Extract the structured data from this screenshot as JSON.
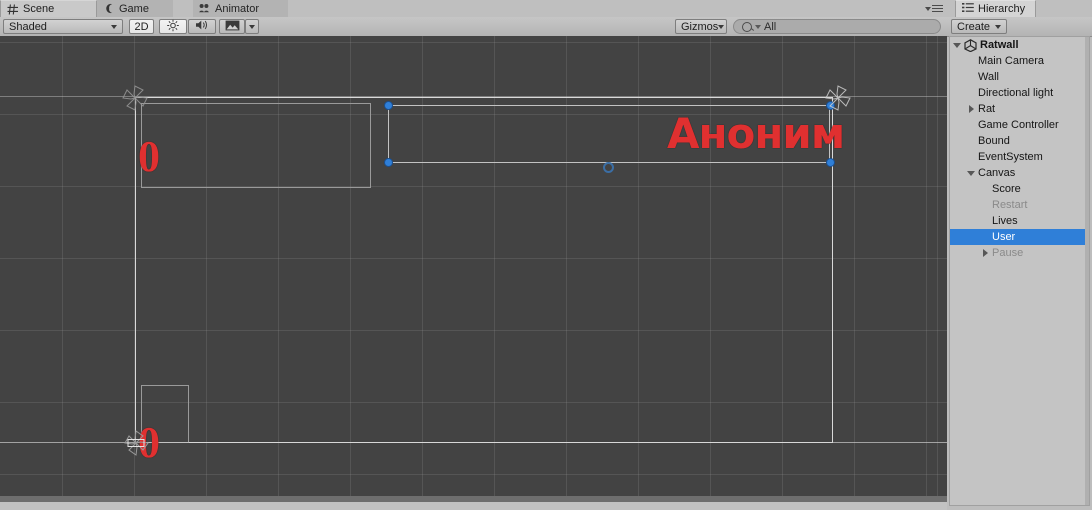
{
  "window": {
    "scene_tabs": [
      {
        "label": "Scene",
        "icon": "grid-icon",
        "active": true
      },
      {
        "label": "Game",
        "icon": "gamepad-icon",
        "active": false
      },
      {
        "label": "Animator",
        "icon": "animator-icon",
        "active": false
      }
    ],
    "tab_menu_icon": "panel-menu-icon"
  },
  "scene_toolbar": {
    "draw_mode": "Shaded",
    "mode_2d": "2D",
    "lighting_icon": "sun-icon",
    "audio_icon": "speaker-icon",
    "effects_icon": "image-icon",
    "effects_caret": "chevron-down-icon",
    "gizmos": "Gizmos",
    "search_placeholder": "All",
    "search_value": "All",
    "search_icon": "search-icon"
  },
  "scene_view": {
    "background_color": "#434343",
    "grid_color": "#8e8e8e",
    "canvas_outline_color": "#d9d9d9",
    "handle_color": "#2f7fd8",
    "text_color": "#e03030",
    "text_outline_color": "#1b1b1b",
    "objects": [
      {
        "name": "score-text",
        "text": "0",
        "role": "Score"
      },
      {
        "name": "lives-text",
        "text": "0",
        "role": "Lives"
      },
      {
        "name": "user-text",
        "text": "Аноним",
        "role": "User"
      }
    ]
  },
  "hierarchy": {
    "tab_label": "Hierarchy",
    "tab_icon": "hierarchy-icon",
    "create_label": "Create",
    "create_caret": "chevron-down-icon",
    "items": [
      {
        "label": "Ratwall",
        "depth": 0,
        "twisty": "down",
        "icon": "unity-scene-icon",
        "root": true,
        "selected": false,
        "dim": false
      },
      {
        "label": "Main Camera",
        "depth": 1,
        "twisty": "none",
        "icon": "none",
        "root": false,
        "selected": false,
        "dim": false
      },
      {
        "label": "Wall",
        "depth": 1,
        "twisty": "none",
        "icon": "none",
        "root": false,
        "selected": false,
        "dim": false
      },
      {
        "label": "Directional light",
        "depth": 1,
        "twisty": "none",
        "icon": "none",
        "root": false,
        "selected": false,
        "dim": false
      },
      {
        "label": "Rat",
        "depth": 1,
        "twisty": "right",
        "icon": "none",
        "root": false,
        "selected": false,
        "dim": false
      },
      {
        "label": "Game Controller",
        "depth": 1,
        "twisty": "none",
        "icon": "none",
        "root": false,
        "selected": false,
        "dim": false
      },
      {
        "label": "Bound",
        "depth": 1,
        "twisty": "none",
        "icon": "none",
        "root": false,
        "selected": false,
        "dim": false
      },
      {
        "label": "EventSystem",
        "depth": 1,
        "twisty": "none",
        "icon": "none",
        "root": false,
        "selected": false,
        "dim": false
      },
      {
        "label": "Canvas",
        "depth": 1,
        "twisty": "down",
        "icon": "none",
        "root": false,
        "selected": false,
        "dim": false
      },
      {
        "label": "Score",
        "depth": 2,
        "twisty": "none",
        "icon": "none",
        "root": false,
        "selected": false,
        "dim": false
      },
      {
        "label": "Restart",
        "depth": 2,
        "twisty": "none",
        "icon": "none",
        "root": false,
        "selected": false,
        "dim": true
      },
      {
        "label": "Lives",
        "depth": 2,
        "twisty": "none",
        "icon": "none",
        "root": false,
        "selected": false,
        "dim": false
      },
      {
        "label": "User",
        "depth": 2,
        "twisty": "none",
        "icon": "none",
        "root": false,
        "selected": true,
        "dim": false
      },
      {
        "label": "Pause",
        "depth": 2,
        "twisty": "right",
        "icon": "none",
        "root": false,
        "selected": false,
        "dim": true
      }
    ]
  }
}
